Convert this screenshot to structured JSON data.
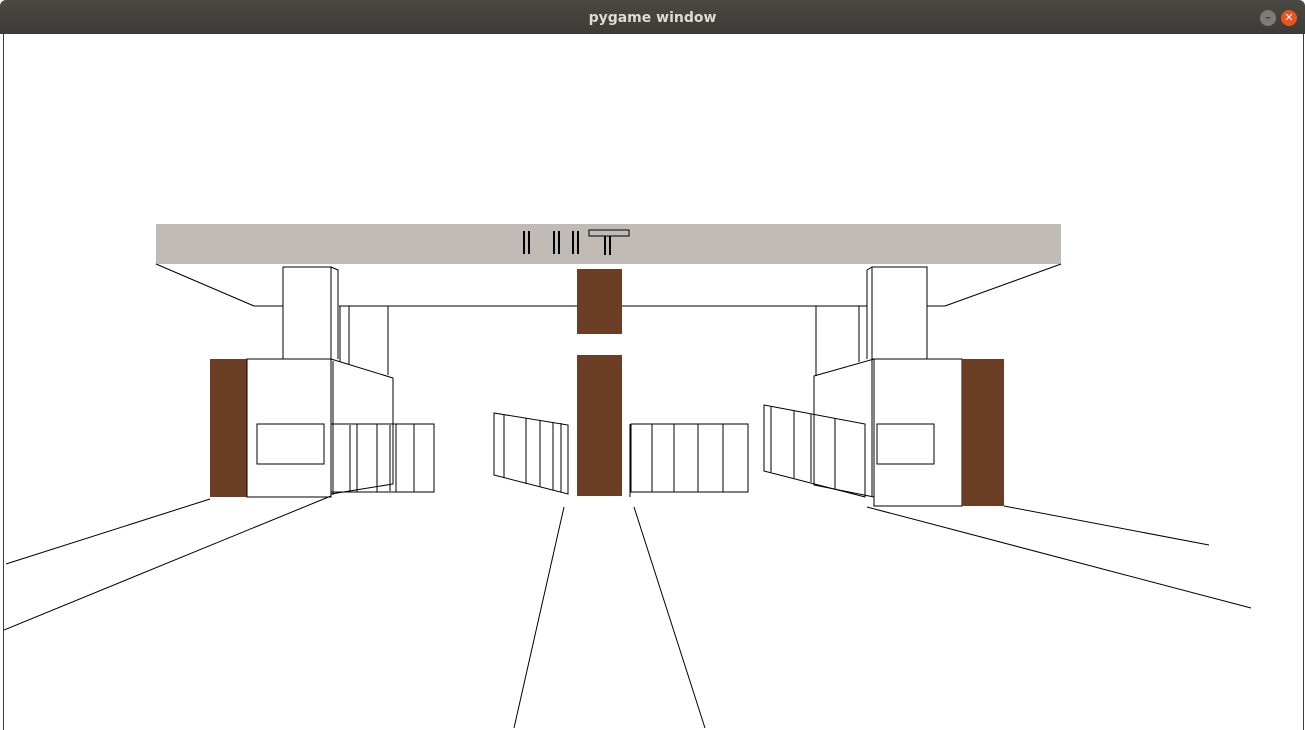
{
  "window": {
    "title": "pygame window"
  },
  "titlebar_buttons": {
    "minimize_glyph": "–",
    "close_glyph": "✕"
  },
  "colors": {
    "titlebar": "#3c3b37",
    "title_text": "#dfdbd2",
    "close_button": "#e95420",
    "banner": "#c0bbb6",
    "pillar": "#6b3d24",
    "line": "#000000",
    "background": "#ffffff"
  },
  "scene": {
    "description_free": true,
    "banner_label_icon": "iit-letters"
  }
}
